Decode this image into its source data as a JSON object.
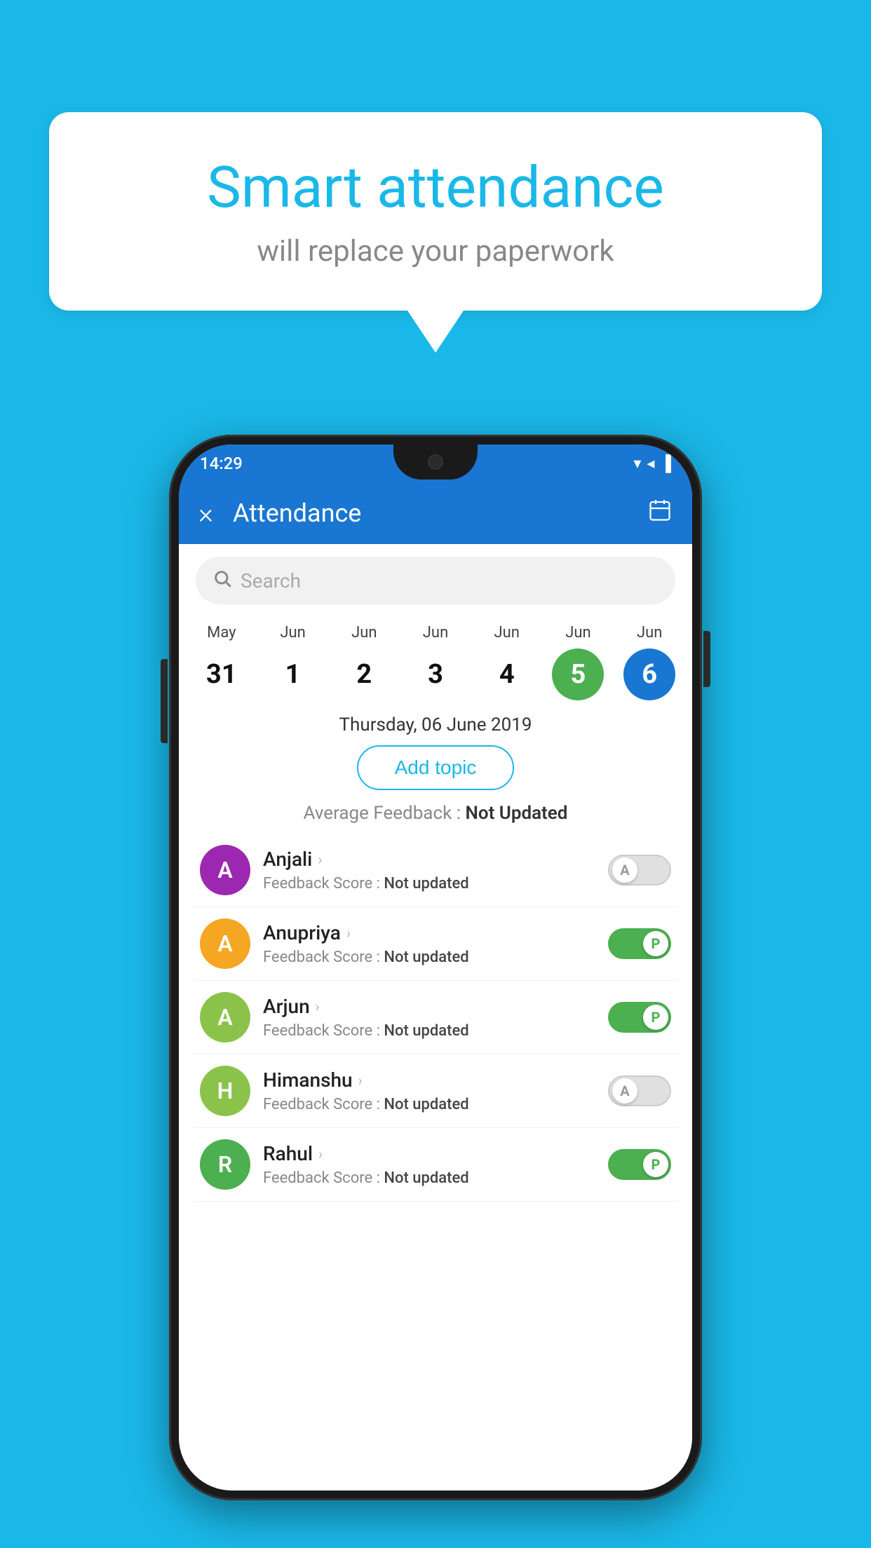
{
  "background_color": "#1ab8e8",
  "speech_bubble": {
    "title": "Smart attendance",
    "subtitle": "will replace your paperwork"
  },
  "status_bar": {
    "time": "14:29",
    "wifi": "▼",
    "signal": "▲",
    "battery": "▐"
  },
  "app_header": {
    "title": "Attendance",
    "close_label": "×",
    "close_icon": "close-icon",
    "calendar_icon": "calendar-icon"
  },
  "search": {
    "placeholder": "Search"
  },
  "calendar": {
    "days": [
      {
        "month": "May",
        "number": "31",
        "state": "normal"
      },
      {
        "month": "Jun",
        "number": "1",
        "state": "normal"
      },
      {
        "month": "Jun",
        "number": "2",
        "state": "normal"
      },
      {
        "month": "Jun",
        "number": "3",
        "state": "normal"
      },
      {
        "month": "Jun",
        "number": "4",
        "state": "normal"
      },
      {
        "month": "Jun",
        "number": "5",
        "state": "today"
      },
      {
        "month": "Jun",
        "number": "6",
        "state": "selected"
      }
    ]
  },
  "selected_date": "Thursday, 06 June 2019",
  "add_topic_label": "Add topic",
  "avg_feedback_label": "Average Feedback :",
  "avg_feedback_value": "Not Updated",
  "students": [
    {
      "name": "Anjali",
      "feedback_label": "Feedback Score :",
      "feedback_value": "Not updated",
      "avatar_letter": "A",
      "avatar_color": "#9c27b0",
      "toggle_state": "off",
      "toggle_letter": "A"
    },
    {
      "name": "Anupriya",
      "feedback_label": "Feedback Score :",
      "feedback_value": "Not updated",
      "avatar_letter": "A",
      "avatar_color": "#f5a623",
      "toggle_state": "on",
      "toggle_letter": "P"
    },
    {
      "name": "Arjun",
      "feedback_label": "Feedback Score :",
      "feedback_value": "Not updated",
      "avatar_letter": "A",
      "avatar_color": "#8bc34a",
      "toggle_state": "on",
      "toggle_letter": "P"
    },
    {
      "name": "Himanshu",
      "feedback_label": "Feedback Score :",
      "feedback_value": "Not updated",
      "avatar_letter": "H",
      "avatar_color": "#8bc34a",
      "toggle_state": "off",
      "toggle_letter": "A"
    },
    {
      "name": "Rahul",
      "feedback_label": "Feedback Score :",
      "feedback_value": "Not updated",
      "avatar_letter": "R",
      "avatar_color": "#4caf50",
      "toggle_state": "on",
      "toggle_letter": "P"
    }
  ]
}
